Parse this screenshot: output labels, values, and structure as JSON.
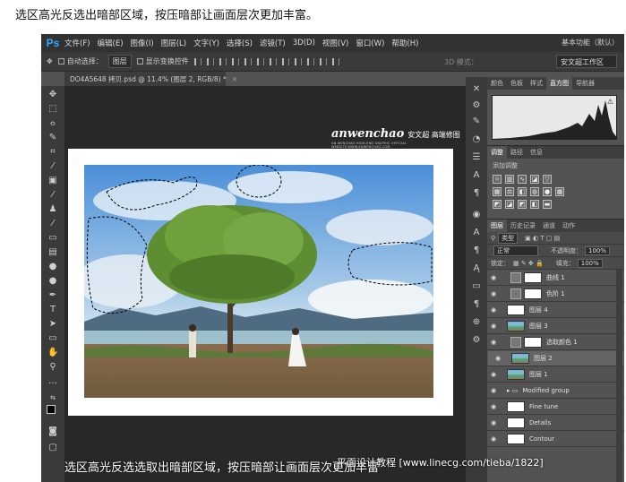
{
  "caption": "选区高光反选出暗部区域，按压暗部让画面层次更加丰富。",
  "app": {
    "logo": "Ps",
    "menu": [
      "文件(F)",
      "编辑(E)",
      "图像(I)",
      "图层(L)",
      "文字(Y)",
      "选择(S)",
      "滤镜(T)",
      "3D(D)",
      "视图(V)",
      "窗口(W)",
      "帮助(H)"
    ],
    "workspace_label": "基本功能（默认）"
  },
  "options_bar": {
    "auto_select_label": "自动选择：",
    "auto_select_value": "图层",
    "show_transform_label": "显示变换控件",
    "mode_3d_label": "3D 模式：",
    "workspace_select": "安文超工作区"
  },
  "document": {
    "tab_title": "DO4A5648 拷贝.psd @ 11.4% (图层 2, RGB/8) *",
    "watermark_main": "anwenchao",
    "watermark_cn": "安文超 高端修图",
    "watermark_sub": "AN WENCHAO HIGH-END GRAPHIC OFFICIAL WEBSITE:WWW.ANWENCHAO.COM",
    "bottom_caption": "选区高光反选选取出暗部区域，按压暗部让画面层次更加丰富",
    "site_watermark": "平面设计教程 [www.linecg.com/tieba/1822]"
  },
  "panels": {
    "top_tabs": [
      "颜色",
      "色板",
      "样式",
      "直方图",
      "导航器"
    ],
    "top_active": "直方图",
    "adj_tabs": [
      "调整",
      "路径",
      "信息"
    ],
    "adj_title": "添加调整",
    "layers_tabs": [
      "图层",
      "历史记录",
      "通道",
      "动作"
    ],
    "kind_label": "类型",
    "blend_mode": "正常",
    "opacity_label": "不透明度：",
    "opacity_value": "100%",
    "lock_label": "锁定：",
    "fill_label": "填充：",
    "fill_value": "100%",
    "layers": [
      {
        "name": "曲线 1",
        "kind": "adjustment"
      },
      {
        "name": "色阶 1",
        "kind": "adjustment"
      },
      {
        "name": "图层 4",
        "kind": "white"
      },
      {
        "name": "图层 3",
        "kind": "photo"
      },
      {
        "name": "选取颜色 1",
        "kind": "adjustment"
      },
      {
        "name": "图层 2",
        "kind": "photo",
        "selected": true
      },
      {
        "name": "图层 1",
        "kind": "photo"
      },
      {
        "name": "Modified group",
        "kind": "group"
      },
      {
        "name": "Fine tune",
        "kind": "white"
      },
      {
        "name": "Details",
        "kind": "white"
      },
      {
        "name": "Contour",
        "kind": "white"
      }
    ]
  }
}
